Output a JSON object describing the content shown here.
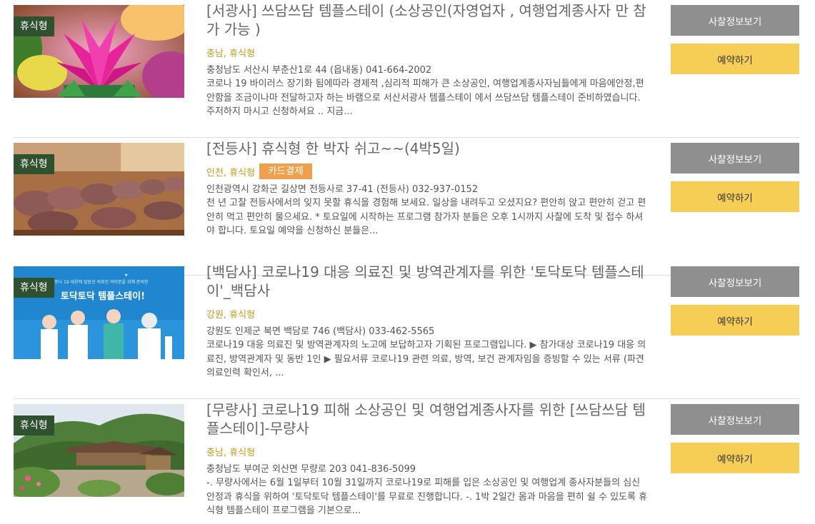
{
  "items": [
    {
      "badge": "휴식형",
      "title": "[서광사] 쓰담쓰담 템플스테이 (소상공인(자영업자 , 여행업계종사자 만 참가 가능 )",
      "tags": "충남, 휴식형",
      "card": null,
      "address": "충청남도 서산시 부춘산1로 44 (읍내동) 041-664-2002",
      "description": "코로나 19 바이러스 장기화 됨에따라 경제적 ,심리적 피해가 큰 소상공인, 여행업계종사자님들에게 마음에안정,편안함을 조금이나마 전달하고자 하는 바램으로 서산서광사 템플스테이 에서 쓰담쓰담 템플스테이 준비하였습니다. 주저하지 마시고 신청하셔요 .. 지금...",
      "info_button": "사찰정보보기",
      "reserve_button": "예약하기",
      "image": "lotus-lantern"
    },
    {
      "badge": "휴식형",
      "title": "[전등사] 휴식형 한 박자 쉬고~~(4박5일)",
      "tags": "인천, 휴식형",
      "card": "카드결제",
      "address": "인천광역시 강화군 길상면 전등사로 37-41 (전등사) 032-937-0152",
      "description": "천 년 고찰 전등사에서의 잊지 못할 휴식을 경험해 보세요. 일상을 내려두고 오셨지요? 편안히 앉고 편안히 걷고 편안히 먹고 편안히 물으세요. * 토요일에 시작하는 프로그램 참가자 분들은 오후 1시까지 사찰에 도착 및 접수 하셔야 합니다. 토요일 예약을 신청하신 분들은...",
      "info_button": "사찰정보보기",
      "reserve_button": "예약하기",
      "image": "bowing-practitioners"
    },
    {
      "badge": "휴식형",
      "title": "[백담사] 코로나19 대응 의료진 및 방역관계자를 위한 '토닥토닥 템플스테이'_백담사",
      "tags": "강원, 휴식형",
      "card": null,
      "address": "강원도 인제군 북면 백담로 746 (백담사) 033-462-5565",
      "description": "코로나19 대응 의료진 및 방역관계자의 노고에 보답하고자 기획된 프로그램입니다. ▶ 참가대상 코로나19 대응 의료진, 방역관계자 및 동반 1인 ▶ 필요서류 코로나19 관련 의료, 방역, 보건 관계자임을 증빙할 수 있는 서류 (파견의료인력 확인서, ...",
      "info_button": "사찰정보보기",
      "reserve_button": "예약하기",
      "image": "medical-staff-illustration",
      "poster_text": {
        "top": "코로나 19 대응에 앞장선 의료진 여러분을 위해 준비한",
        "main": "토닥토닥 템플스테이!"
      }
    },
    {
      "badge": "휴식형",
      "title": "[무량사] 코로나19 피해 소상공인 및 여행업계종사자를 위한 [쓰담쓰담 템플스테이]-무량사",
      "tags": "충남, 휴식형",
      "card": null,
      "address": "충청남도 부여군 외산면 무량로 203 041-836-5099",
      "description": "-. 무량사에서는 6월 1일부터 10월 31일까지 코로나19로 피해를 입은 소상공인 및 여행업계 종사자분들의 심신 안정과 휴식을 위하여 '토닥토닥 템플스테이'를 무료로 진행합니다. -. 1박 2일간 몸과 마음을 편히 쉴 수 있도록 휴식형 템플스테이 프로그램을 기본으로...",
      "info_button": "사찰정보보기",
      "reserve_button": "예약하기",
      "image": "temple-mountain"
    }
  ]
}
